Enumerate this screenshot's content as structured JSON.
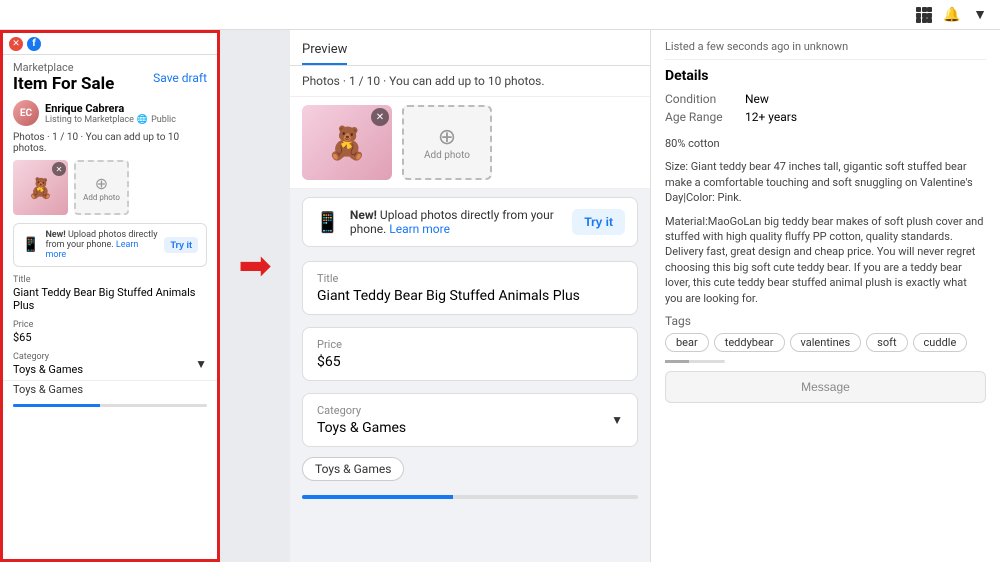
{
  "topbar": {
    "icons": [
      "grid-icon",
      "bell-icon",
      "chevron-down-icon"
    ]
  },
  "sidebar": {
    "browser_tabs": [
      "close",
      "facebook"
    ],
    "header": {
      "marketplace_label": "Marketplace",
      "title": "Item For Sale",
      "save_draft": "Save draft"
    },
    "user": {
      "name": "Enrique Cabrera",
      "listing_to": "Listing to Marketplace",
      "visibility": "Public"
    },
    "photos_label": "Photos · 1 / 10 · You can add up to 10 photos.",
    "upload_banner": {
      "badge": "New!",
      "text": "Upload photos directly from your phone.",
      "learn_more": "Learn more",
      "try_it": "Try it"
    },
    "title_field": {
      "label": "Title",
      "value": "Giant Teddy Bear Big Stuffed Animals Plus"
    },
    "price_field": {
      "label": "Price",
      "value": "$65"
    },
    "category_field": {
      "label": "Category",
      "value": "Toys & Games"
    },
    "tags_value": "Toys & Games"
  },
  "preview": {
    "tab_label": "Preview",
    "photos_header": "Photos · 1 / 10 · You can add up to 10 photos.",
    "add_photo_label": "Add photo",
    "upload_banner": {
      "badge": "New!",
      "text": "Upload photos directly from your phone.",
      "learn_more": "Learn more",
      "try_it": "Try it"
    },
    "title_field": {
      "label": "Title",
      "value": "Giant Teddy Bear Big Stuffed Animals Plus"
    },
    "price_field": {
      "label": "Price",
      "value": "$65"
    },
    "category_field": {
      "label": "Category",
      "value": "Toys & Games"
    },
    "category_tag": "Toys & Games"
  },
  "right_panel": {
    "top_text": "Listed a few seconds ago in unknown",
    "details_title": "Details",
    "condition_label": "Condition",
    "condition_value": "New",
    "age_range_label": "Age Range",
    "age_range_value": "12+ years",
    "description_1": "80% cotton",
    "description_2": "Size: Giant teddy bear 47 inches tall, gigantic soft stuffed bear make a comfortable touching and soft snuggling on Valentine's Day|Color: Pink.",
    "description_3": "Material:MaoGoLan big teddy bear makes of soft plush cover and stuffed with high quality fluffy PP cotton, quality standards. Delivery fast, great design and cheap price. You will never regret choosing this big soft cute teddy bear. If you are a teddy bear lover, this cute teddy bear stuffed animal plush is exactly what you are looking for.",
    "tags_label": "Tags",
    "tags": [
      "bear",
      "teddybear",
      "valentines",
      "soft",
      "cuddle"
    ],
    "message_btn": "Message"
  }
}
